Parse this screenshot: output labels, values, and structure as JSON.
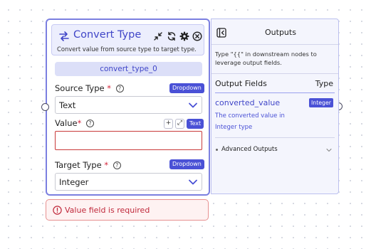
{
  "node": {
    "title": "Convert Type",
    "description": "Convert value from source type to target type.",
    "id_badge": "convert_type_0",
    "icons": [
      "swap-arrows-icon",
      "collapse-icon",
      "refresh-icon",
      "settings-gear-icon",
      "close-circle-icon"
    ],
    "source_type": {
      "label": "Source Type",
      "required": "*",
      "mode_chip": "Dropdown",
      "value": "Text"
    },
    "value_field": {
      "label": "Value",
      "required": "*",
      "add_label": "+",
      "expand_label": "⤢",
      "type_chip": "Text",
      "value": ""
    },
    "target_type": {
      "label": "Target Type",
      "required": "*",
      "mode_chip": "Dropdown",
      "value": "Integer"
    },
    "help_glyph": "?"
  },
  "error": {
    "message": "Value field is required",
    "icon": "alert-circle-icon"
  },
  "outputs": {
    "title": "Outputs",
    "hint_line1": "Type \"{{\" in downstream nodes to",
    "hint_line2": "leverage output fields.",
    "col_fields": "Output Fields",
    "col_type": "Type",
    "field": {
      "name": "converted_value",
      "type": "Integer",
      "desc_line1": "The converted value in",
      "desc_line2": "Integer type"
    },
    "advanced_label": "Advanced Outputs"
  },
  "colors": {
    "accent": "#4a51d6",
    "node_border": "#7b7fe0",
    "error": "#c0293b",
    "panel_bg": "#f4f5fd"
  }
}
